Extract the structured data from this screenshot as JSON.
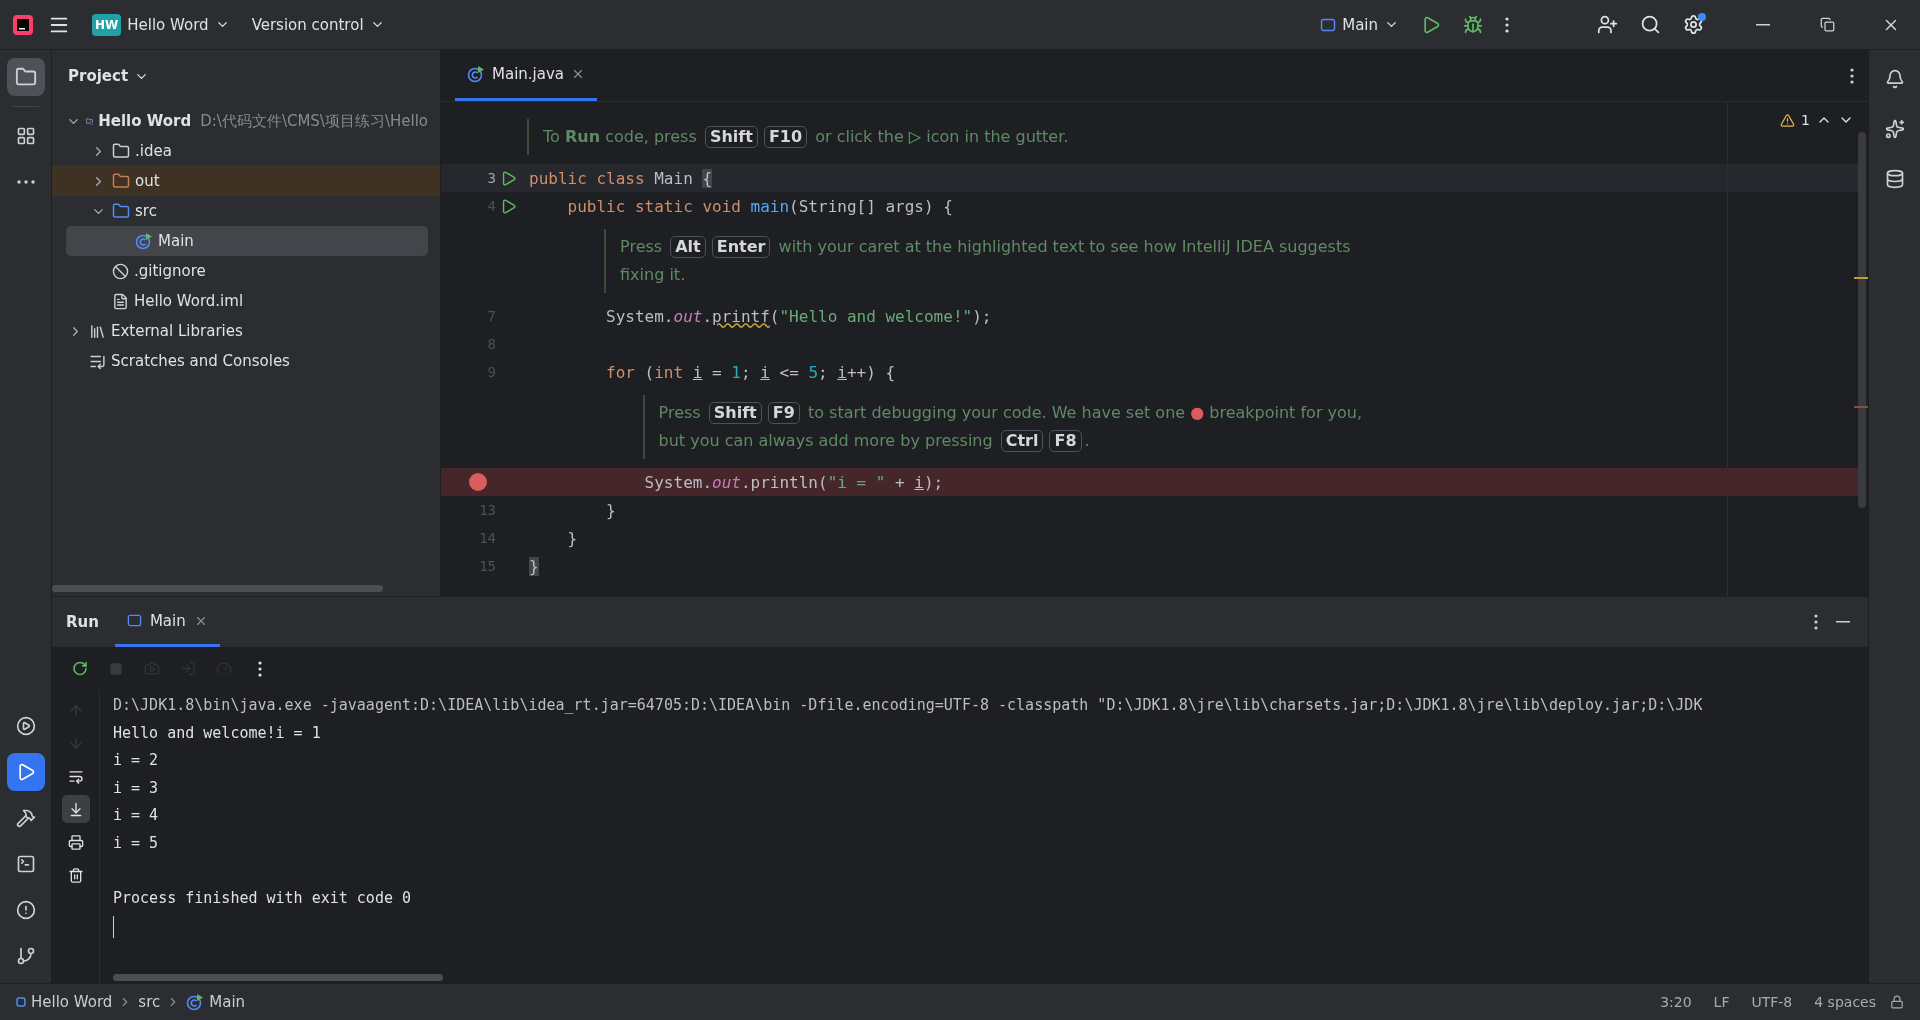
{
  "title_bar": {
    "project_badge": "HW",
    "project": "Hello Word",
    "vcs": "Version control",
    "run_config": "Main"
  },
  "left_stripe": {
    "top": [
      {
        "kind": "project",
        "selected": true
      },
      {
        "kind": "structure",
        "selected": false
      },
      {
        "kind": "more",
        "selected": false
      }
    ],
    "bottom": [
      {
        "kind": "services",
        "selected": false
      },
      {
        "kind": "run",
        "selected": true
      },
      {
        "kind": "build",
        "selected": false
      },
      {
        "kind": "terminal",
        "selected": false
      },
      {
        "kind": "problems",
        "selected": false
      },
      {
        "kind": "git",
        "selected": false
      }
    ]
  },
  "project_panel": {
    "title": "Project",
    "tree": [
      {
        "kind": "module",
        "name": "Hello Word",
        "path": "D:\\代码文件\\CMS\\项目练习\\Hello",
        "expanded": true,
        "selected": false,
        "children": [
          {
            "kind": "folder",
            "name": ".idea",
            "expanded": false,
            "selected": false
          },
          {
            "kind": "excluded",
            "name": "out",
            "expanded": false,
            "selected": false
          },
          {
            "kind": "source",
            "name": "src",
            "expanded": true,
            "selected": false,
            "children": [
              {
                "kind": "class",
                "name": "Main",
                "selected": true
              }
            ]
          },
          {
            "kind": "ignore",
            "name": ".gitignore",
            "selected": false
          },
          {
            "kind": "iml",
            "name": "Hello Word.iml",
            "selected": false
          }
        ]
      },
      {
        "kind": "libraries",
        "name": "External Libraries",
        "expanded": false,
        "selected": false
      },
      {
        "kind": "scratches",
        "name": "Scratches and Consoles",
        "selected": false
      }
    ]
  },
  "editor": {
    "tabs": [
      {
        "label": "Main.java",
        "selected": true
      }
    ],
    "warnings": "1",
    "lines": [
      {
        "kind": "hint",
        "segments": [
          {
            "kind": "text",
            "text": "To "
          },
          {
            "kind": "bold",
            "text": "Run"
          },
          {
            "kind": "text",
            "text": " code, press "
          },
          {
            "kind": "key",
            "text": "Shift"
          },
          {
            "kind": "key",
            "text": "F10"
          },
          {
            "kind": "text",
            "text": " or click the "
          },
          {
            "kind": "run",
            "text": "▷"
          },
          {
            "kind": "text",
            "text": " icon in the gutter."
          }
        ]
      },
      {
        "kind": "code",
        "number": "3",
        "run_gutter": true,
        "current": true,
        "tokens": [
          {
            "kind": "kw",
            "text": "public class "
          },
          {
            "kind": "plain",
            "text": "Main "
          },
          {
            "kind": "brace",
            "text": "{"
          }
        ]
      },
      {
        "kind": "code",
        "number": "4",
        "run_gutter": true,
        "tokens": [
          {
            "kind": "kw",
            "text": "    public static void "
          },
          {
            "kind": "method",
            "text": "main"
          },
          {
            "kind": "plain",
            "text": "(String[] args) {"
          }
        ]
      },
      {
        "kind": "hint",
        "segments": [
          {
            "kind": "text",
            "text": "Press "
          },
          {
            "kind": "key",
            "text": "Alt"
          },
          {
            "kind": "key",
            "text": "Enter"
          },
          {
            "kind": "text",
            "text": " with your caret at the highlighted text to see how IntelliJ IDEA suggests fixing it."
          }
        ]
      },
      {
        "kind": "code",
        "number": "7",
        "tokens": [
          {
            "kind": "plain",
            "text": "        System."
          },
          {
            "kind": "static",
            "text": "out"
          },
          {
            "kind": "plain",
            "text": "."
          },
          {
            "kind": "warn",
            "text": "printf"
          },
          {
            "kind": "plain",
            "text": "("
          },
          {
            "kind": "str",
            "text": "\"Hello and welcome!\""
          },
          {
            "kind": "plain",
            "text": ");"
          }
        ]
      },
      {
        "kind": "code",
        "number": "8"
      },
      {
        "kind": "code",
        "number": "9",
        "tokens": [
          {
            "kind": "kw",
            "text": "        for"
          },
          {
            "kind": "plain",
            "text": " ("
          },
          {
            "kind": "kw",
            "text": "int "
          },
          {
            "kind": "var",
            "text": "i"
          },
          {
            "kind": "plain",
            "text": " = "
          },
          {
            "kind": "num",
            "text": "1"
          },
          {
            "kind": "plain",
            "text": "; "
          },
          {
            "kind": "var",
            "text": "i"
          },
          {
            "kind": "plain",
            "text": " <= "
          },
          {
            "kind": "num",
            "text": "5"
          },
          {
            "kind": "plain",
            "text": "; "
          },
          {
            "kind": "var",
            "text": "i"
          },
          {
            "kind": "plain",
            "text": "++) {"
          }
        ]
      },
      {
        "kind": "hint",
        "segments": [
          {
            "kind": "text",
            "text": "Press "
          },
          {
            "kind": "key",
            "text": "Shift"
          },
          {
            "kind": "key",
            "text": "F9"
          },
          {
            "kind": "text",
            "text": " to start debugging your code. We have set one "
          },
          {
            "kind": "dot",
            "text": "●"
          },
          {
            "kind": "text",
            "text": " breakpoint for you, but you can always add more by pressing "
          },
          {
            "kind": "key",
            "text": "Ctrl"
          },
          {
            "kind": "key",
            "text": "F8"
          },
          {
            "kind": "text",
            "text": "."
          }
        ]
      },
      {
        "kind": "code",
        "breakpoint": true,
        "tokens": [
          {
            "kind": "plain",
            "text": "            System."
          },
          {
            "kind": "static",
            "text": "out"
          },
          {
            "kind": "plain",
            "text": ".println("
          },
          {
            "kind": "str",
            "text": "\"i = \""
          },
          {
            "kind": "plain",
            "text": " + "
          },
          {
            "kind": "var",
            "text": "i"
          },
          {
            "kind": "plain",
            "text": ");"
          }
        ]
      },
      {
        "kind": "code",
        "number": "13",
        "tokens": [
          {
            "kind": "plain",
            "text": "        }"
          }
        ]
      },
      {
        "kind": "code",
        "number": "14",
        "tokens": [
          {
            "kind": "plain",
            "text": "    }"
          }
        ]
      },
      {
        "kind": "code",
        "number": "15",
        "tokens": [
          {
            "kind": "brace",
            "text": "}"
          }
        ]
      }
    ]
  },
  "run_panel": {
    "title": "Run",
    "tabs": [
      {
        "label": "Main",
        "selected": true
      }
    ],
    "tools": [
      {
        "kind": "rerun",
        "disabled": false
      },
      {
        "kind": "stop",
        "disabled": true
      },
      {
        "kind": "snapshot",
        "disabled": true
      },
      {
        "kind": "export",
        "disabled": true
      },
      {
        "kind": "restore",
        "disabled": true
      },
      {
        "kind": "more",
        "disabled": false
      }
    ],
    "side_tools": [
      {
        "kind": "up",
        "disabled": true,
        "selected": false
      },
      {
        "kind": "down",
        "disabled": true,
        "selected": false
      },
      {
        "kind": "wrap",
        "disabled": false,
        "selected": false
      },
      {
        "kind": "scroll-end",
        "disabled": false,
        "selected": true
      },
      {
        "kind": "print",
        "disabled": false,
        "selected": false
      },
      {
        "kind": "clear",
        "disabled": false,
        "selected": false
      }
    ],
    "console": [
      {
        "kind": "command",
        "text": "D:\\JDK1.8\\bin\\java.exe -javaagent:D:\\IDEA\\lib\\idea_rt.jar=64705:D:\\IDEA\\bin -Dfile.encoding=UTF-8 -classpath \"D:\\JDK1.8\\jre\\lib\\charsets.jar;D:\\JDK1.8\\jre\\lib\\deploy.jar;D:\\JDK"
      },
      {
        "kind": "output",
        "text": "Hello and welcome!i = 1"
      },
      {
        "kind": "output",
        "text": "i = 2"
      },
      {
        "kind": "output",
        "text": "i = 3"
      },
      {
        "kind": "output",
        "text": "i = 4"
      },
      {
        "kind": "output",
        "text": "i = 5"
      },
      {
        "kind": "status",
        "text": "Process finished with exit code 0"
      }
    ]
  },
  "status_bar": {
    "breadcrumbs": [
      {
        "kind": "module",
        "label": "Hello Word"
      },
      {
        "kind": "folder",
        "label": "src"
      },
      {
        "kind": "class",
        "label": "Main"
      }
    ],
    "widgets": [
      "3:20",
      "LF",
      "UTF-8",
      "4 spaces"
    ]
  }
}
